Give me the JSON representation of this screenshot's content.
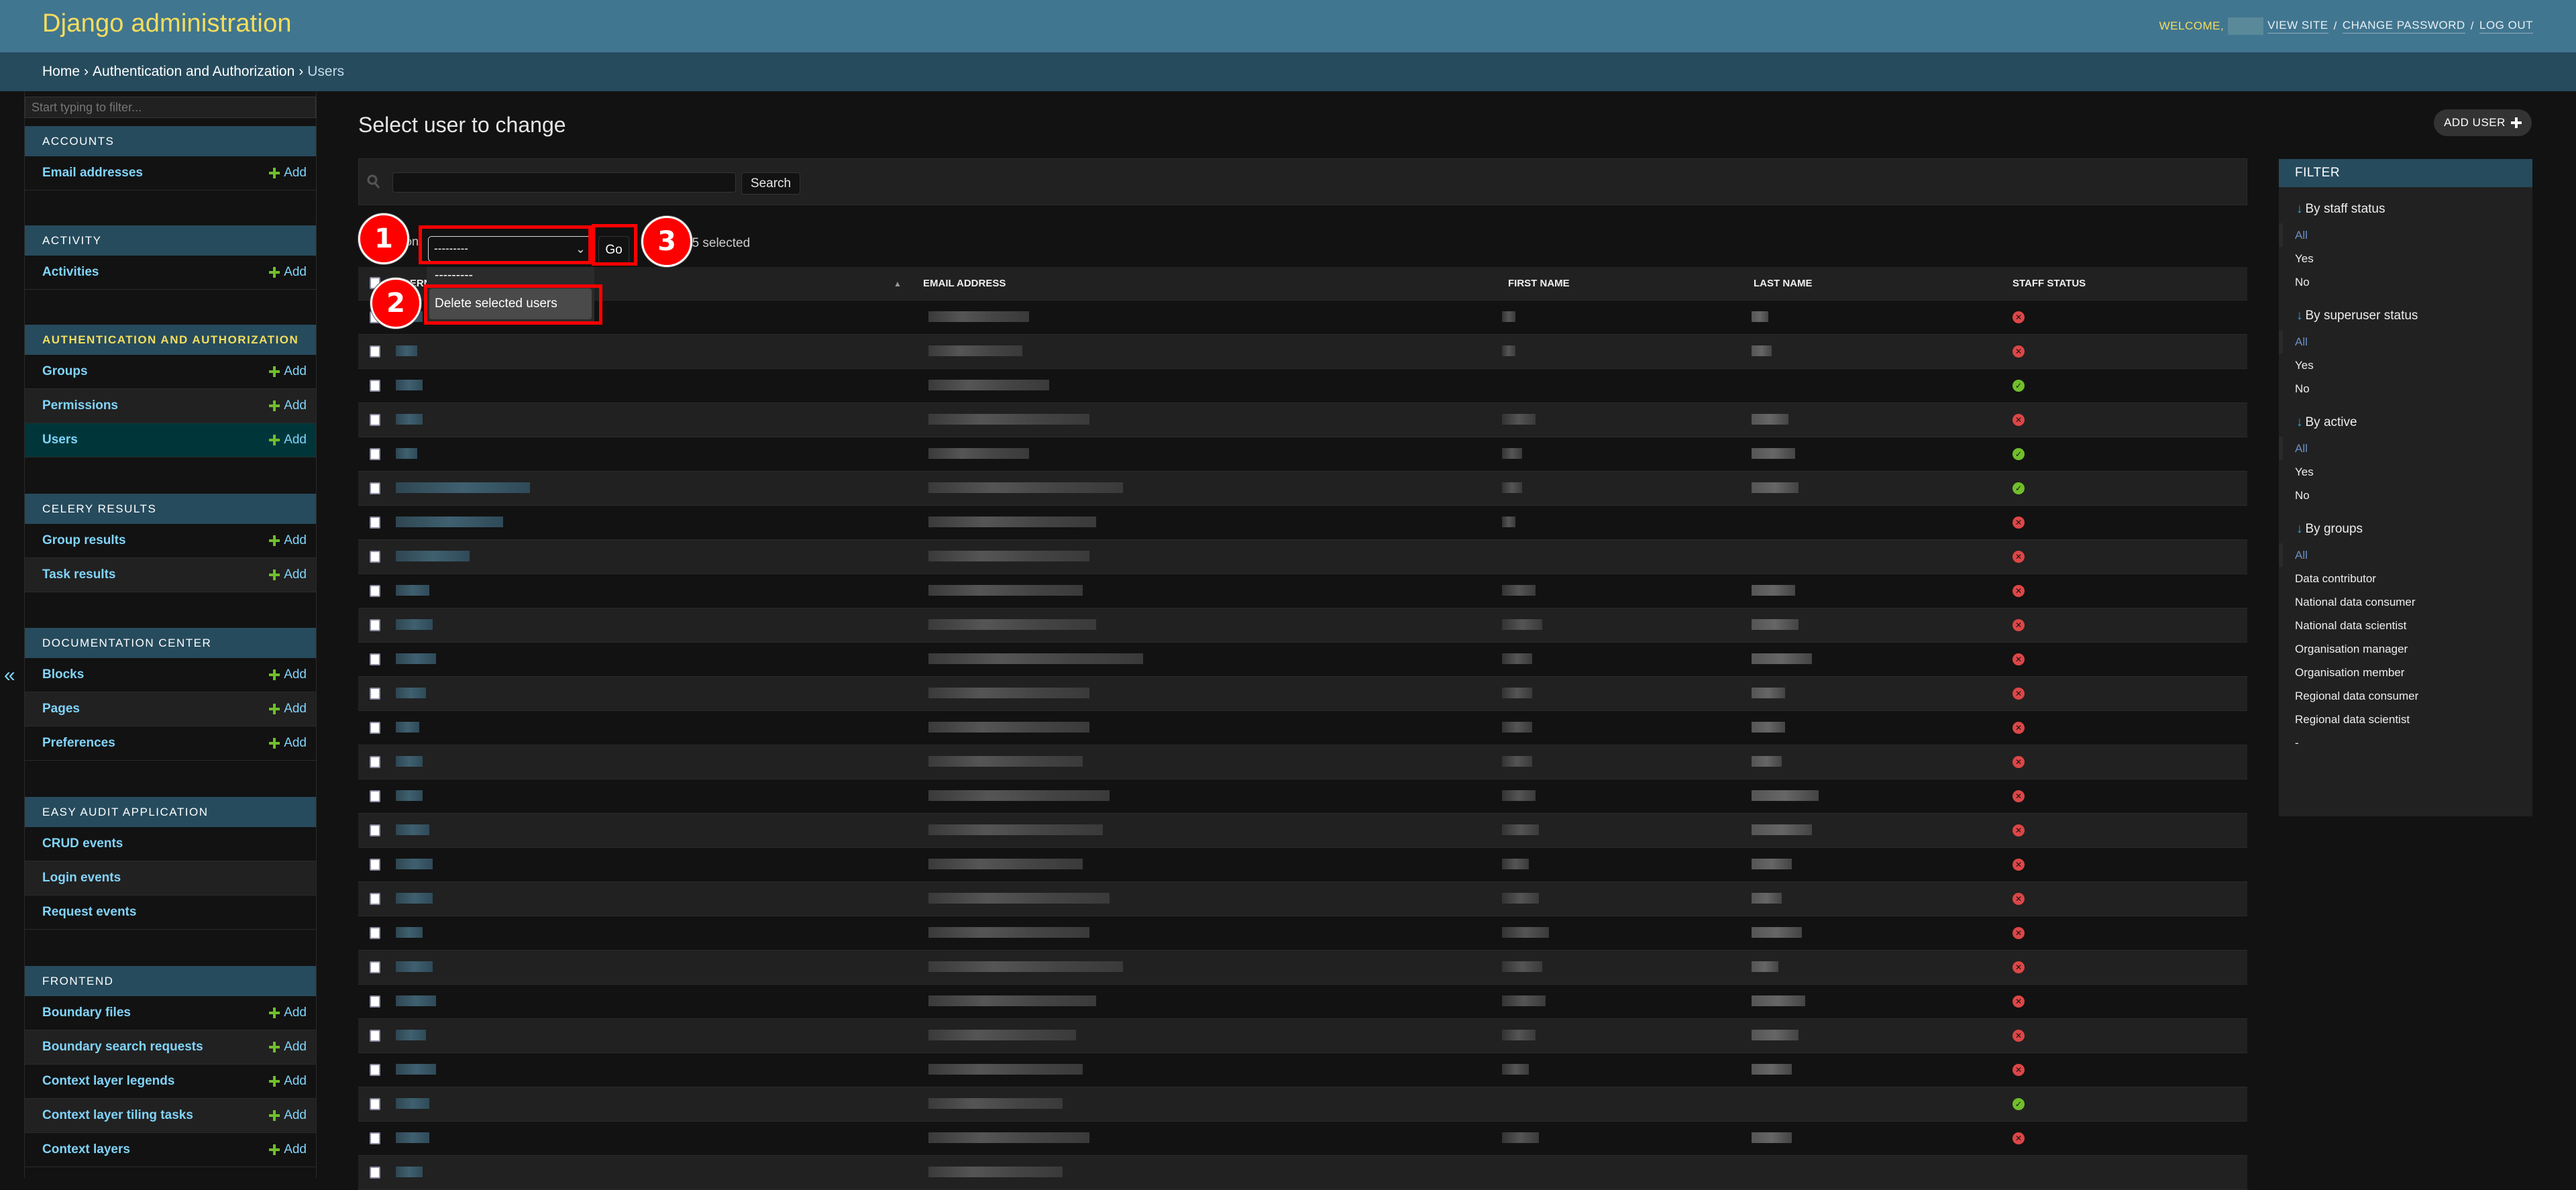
{
  "header": {
    "title": "Django administration",
    "welcome": "Welcome,",
    "view_site": "View site",
    "change_password": "Change password",
    "log_out": "Log out",
    "separator": "/"
  },
  "breadcrumbs": {
    "items": [
      "Home",
      "Authentication and Authorization",
      "Users"
    ],
    "separator": "›"
  },
  "sidebar": {
    "filter_placeholder": "Start typing to filter...",
    "toggle": "«",
    "add_label": "Add",
    "modules": [
      {
        "caption": "Accounts",
        "models": [
          {
            "label": "Email addresses",
            "add": true
          }
        ]
      },
      {
        "caption": "Activity",
        "models": [
          {
            "label": "Activities",
            "add": true
          }
        ]
      },
      {
        "caption": "Authentication and Authorization",
        "current": true,
        "models": [
          {
            "label": "Groups",
            "add": true
          },
          {
            "label": "Permissions",
            "add": true
          },
          {
            "label": "Users",
            "add": true,
            "current": true
          }
        ]
      },
      {
        "caption": "Celery Results",
        "models": [
          {
            "label": "Group results",
            "add": true
          },
          {
            "label": "Task results",
            "add": true
          }
        ]
      },
      {
        "caption": "Documentation Center",
        "models": [
          {
            "label": "Blocks",
            "add": true
          },
          {
            "label": "Pages",
            "add": true
          },
          {
            "label": "Preferences",
            "add": true
          }
        ]
      },
      {
        "caption": "Easy Audit Application",
        "models": [
          {
            "label": "CRUD events",
            "add": false
          },
          {
            "label": "Login events",
            "add": false
          },
          {
            "label": "Request events",
            "add": false
          }
        ]
      },
      {
        "caption": "Frontend",
        "models": [
          {
            "label": "Boundary files",
            "add": true
          },
          {
            "label": "Boundary search requests",
            "add": true
          },
          {
            "label": "Context layer legends",
            "add": true
          },
          {
            "label": "Context layer tiling tasks",
            "add": true
          },
          {
            "label": "Context layers",
            "add": true
          }
        ]
      }
    ]
  },
  "main": {
    "title": "Select user to change",
    "add_button": "Add user",
    "search_button": "Search",
    "search_value": "",
    "action_label": "Action:",
    "action_selected": "---------",
    "go_button": "Go",
    "selected_text": "0 of 25 selected",
    "dropdown_options": [
      "---------",
      "Delete selected users"
    ],
    "columns": [
      "Username",
      "Email address",
      "First name",
      "Last name",
      "Staff status"
    ],
    "sort_indicator": "▲",
    "rows": [
      {
        "staff": false
      },
      {
        "staff": false
      },
      {
        "staff": true
      },
      {
        "staff": false
      },
      {
        "staff": true
      },
      {
        "staff": true
      },
      {
        "staff": false
      },
      {
        "staff": false
      },
      {
        "staff": false
      },
      {
        "staff": false
      },
      {
        "staff": false
      },
      {
        "staff": false
      },
      {
        "staff": false
      },
      {
        "staff": false
      },
      {
        "staff": false
      },
      {
        "staff": false
      },
      {
        "staff": false
      },
      {
        "staff": false
      },
      {
        "staff": false
      },
      {
        "staff": false
      },
      {
        "staff": false
      },
      {
        "staff": false
      },
      {
        "staff": false
      },
      {
        "staff": true
      },
      {
        "staff": false
      },
      {
        "staff": null
      }
    ]
  },
  "annotations": {
    "steps": [
      "1",
      "2",
      "3"
    ]
  },
  "filter": {
    "title": "Filter",
    "groups": [
      {
        "title": "By staff status",
        "options": [
          "All",
          "Yes",
          "No"
        ],
        "selected": "All"
      },
      {
        "title": "By superuser status",
        "options": [
          "All",
          "Yes",
          "No"
        ],
        "selected": "All"
      },
      {
        "title": "By active",
        "options": [
          "All",
          "Yes",
          "No"
        ],
        "selected": "All"
      },
      {
        "title": "By groups",
        "options": [
          "All",
          "Data contributor",
          "National data consumer",
          "National data scientist",
          "Organisation manager",
          "Organisation member",
          "Regional data consumer",
          "Regional data scientist",
          "-"
        ],
        "selected": "All"
      }
    ]
  },
  "colors": {
    "header_bg": "#417690",
    "breadcrumb_bg": "#264b5d",
    "title": "#f5dd5d",
    "link": "#81d4fa",
    "add_plus": "#70bf2b",
    "status_yes": "#70bf2b",
    "status_no": "#dd4646",
    "annotation": "#ff0000"
  }
}
